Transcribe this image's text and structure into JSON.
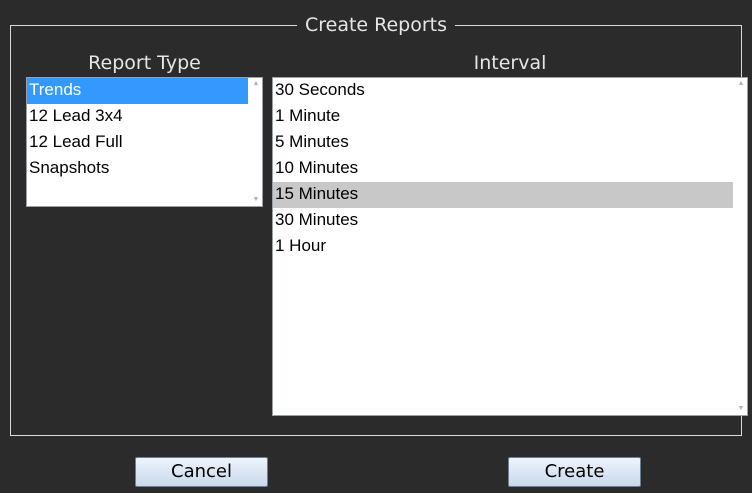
{
  "dialog": {
    "title": "Create Reports"
  },
  "report_type": {
    "label": "Report Type",
    "items": [
      "Trends",
      "12 Lead 3x4",
      "12 Lead Full",
      "Snapshots"
    ],
    "selected_index": 0
  },
  "interval": {
    "label": "Interval",
    "items": [
      "30 Seconds",
      "1 Minute",
      "5 Minutes",
      "10 Minutes",
      "15 Minutes",
      "30 Minutes",
      "1 Hour"
    ],
    "selected_index": 4
  },
  "buttons": {
    "cancel_label": "Cancel",
    "create_label": "Create"
  },
  "icons": {
    "scroll_up": "scroll-up-arrow-icon",
    "scroll_down": "scroll-down-arrow-icon"
  },
  "colors": {
    "background": "#2b2b2b",
    "selection_blue": "#3399ff",
    "selection_grey": "#c8c8c8"
  }
}
